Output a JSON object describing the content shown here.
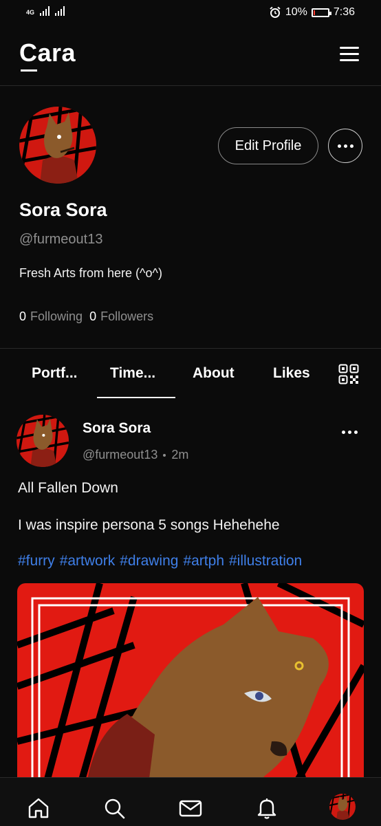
{
  "status_bar": {
    "network": "4G",
    "battery": "10%",
    "battery_level": 0.1,
    "time": "7:36"
  },
  "app": {
    "logo": "Cara"
  },
  "profile": {
    "name": "Sora Sora",
    "handle": "@furmeout13",
    "bio": "Fresh Arts from here (^o^)",
    "following_count": "0",
    "following_label": "Following",
    "followers_count": "0",
    "followers_label": "Followers",
    "edit_profile_label": "Edit Profile"
  },
  "tabs": [
    {
      "label": "Portf..."
    },
    {
      "label": "Time..."
    },
    {
      "label": "About"
    },
    {
      "label": "Likes"
    }
  ],
  "active_tab": "Time...",
  "post": {
    "author": "Sora Sora",
    "handle": "@furmeout13",
    "time": "2m",
    "title": "All Fallen Down",
    "body": "I was inspire persona 5 songs Hehehehe",
    "tags": [
      "#furry",
      "#artwork",
      "#drawing",
      "#artph",
      "#illustration"
    ]
  },
  "bottom_nav": [
    {
      "icon": "home-icon"
    },
    {
      "icon": "search-icon"
    },
    {
      "icon": "mail-icon"
    },
    {
      "icon": "bell-icon"
    },
    {
      "icon": "avatar"
    }
  ],
  "colors": {
    "background": "#0b0b0b",
    "hashtag": "#3f7fe8",
    "muted_text": "#8f8f8f",
    "art_red": "#e11a12",
    "art_fur": "#8b5a2b"
  }
}
